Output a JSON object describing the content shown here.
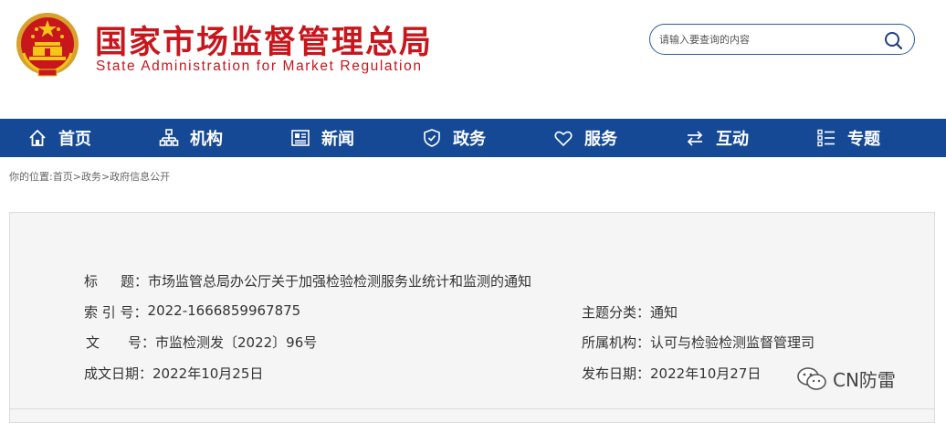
{
  "header": {
    "title_cn": "国家市场监督管理总局",
    "title_en": "State Administration for Market Regulation",
    "emblem_icon": "national-emblem-icon",
    "brand_color": "#c8161d"
  },
  "search": {
    "placeholder": "请输入要查询的内容",
    "icon": "search-icon"
  },
  "nav": {
    "background": "#154995",
    "items": [
      {
        "label": "首页",
        "icon": "home-icon"
      },
      {
        "label": "机构",
        "icon": "org-chart-icon"
      },
      {
        "label": "新闻",
        "icon": "news-icon"
      },
      {
        "label": "政务",
        "icon": "shield-icon"
      },
      {
        "label": "服务",
        "icon": "heart-icon"
      },
      {
        "label": "互动",
        "icon": "exchange-icon"
      },
      {
        "label": "专题",
        "icon": "list-icon"
      }
    ]
  },
  "breadcrumb": {
    "prefix": "你的位置:",
    "items": [
      "首页",
      "政务",
      "政府信息公开"
    ],
    "separator": ">"
  },
  "doc_info": {
    "title_label_a": "标",
    "title_label_b": "题：",
    "title_value": "市场监管总局办公厅关于加强检验检测服务业统计和监测的通知",
    "index_label": "索 引 号：",
    "index_value": "2022-1666859967875",
    "category_label": "主题分类：",
    "category_value": "通知",
    "docno_label_a": "文",
    "docno_label_b": "号：",
    "docno_value": "市监检测发〔2022〕96号",
    "agency_label": "所属机构：",
    "agency_value": "认可与检验检测监督管理司",
    "created_label": "成文日期：",
    "created_value": "2022年10月25日",
    "published_label": "发布日期：",
    "published_value": "2022年10月27日"
  },
  "watermark": {
    "text": "CN防雷",
    "icon": "wechat-icon"
  }
}
